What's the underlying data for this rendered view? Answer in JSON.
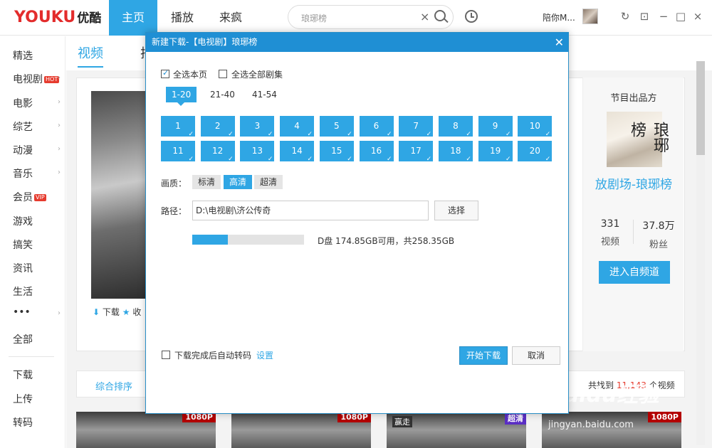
{
  "app": {
    "logo": "YOUKU",
    "logo_cn": "优酷",
    "nav": [
      "主页",
      "播放",
      "来疯"
    ],
    "search_placeholder": "琅琊榜",
    "username": "陪你M...",
    "accent": "#2fa6e4"
  },
  "sidebar": {
    "items": [
      {
        "label": "精选",
        "badge": "",
        "arrow": ""
      },
      {
        "label": "电视剧",
        "badge": "HOT",
        "arrow": "›"
      },
      {
        "label": "电影",
        "badge": "",
        "arrow": "›"
      },
      {
        "label": "综艺",
        "badge": "",
        "arrow": "›"
      },
      {
        "label": "动漫",
        "badge": "",
        "arrow": "›"
      },
      {
        "label": "音乐",
        "badge": "",
        "arrow": "›"
      },
      {
        "label": "会员",
        "badge": "VIP",
        "arrow": ""
      },
      {
        "label": "游戏",
        "badge": "",
        "arrow": ""
      },
      {
        "label": "搞笑",
        "badge": "",
        "arrow": ""
      },
      {
        "label": "资讯",
        "badge": "",
        "arrow": ""
      },
      {
        "label": "生活",
        "badge": "",
        "arrow": ""
      },
      {
        "label": "•••",
        "badge": "",
        "arrow": "›"
      },
      {
        "label": "全部",
        "badge": "",
        "arrow": ""
      }
    ],
    "bottom": [
      "下载",
      "上传",
      "转码"
    ]
  },
  "content": {
    "tab_active": "视频",
    "tab_other": "排",
    "download_label": "下载",
    "collect_label": "收",
    "sort_label": "综合排序",
    "count_prefix": "共找到",
    "count_value": "11,143",
    "count_suffix": "个视频",
    "thumb_badges": [
      "1080P",
      "1080P",
      "超清",
      "1080P"
    ],
    "thumb_label": "赢走"
  },
  "channel": {
    "title": "节目出品方",
    "name": "放剧场-琅琊榜",
    "poster_text": "琅琊榜",
    "videos_count": "331",
    "videos_label": "视频",
    "fans_count": "37.8万",
    "fans_label": "粉丝",
    "enter_button": "进入自频道"
  },
  "dialog": {
    "title": "新建下载-【电视剧】琅琊榜",
    "select_page": "全选本页",
    "select_all": "全选全部剧集",
    "ranges": [
      "1-20",
      "21-40",
      "41-54"
    ],
    "episodes": [
      "1",
      "2",
      "3",
      "4",
      "5",
      "6",
      "7",
      "8",
      "9",
      "10",
      "11",
      "12",
      "13",
      "14",
      "15",
      "16",
      "17",
      "18",
      "19",
      "20"
    ],
    "quality_label": "画质：",
    "qualities": [
      "标清",
      "高清",
      "超清"
    ],
    "path_label": "路径：",
    "path_value": "D:\\电视剧\\济公传奇",
    "choose_button": "选择",
    "disk_usage_fraction": 0.32,
    "disk_info": "D盘 174.85GB可用，共258.35GB",
    "auto_transcode": "下载完成后自动转码",
    "settings_link": "设置",
    "start_button": "开始下载",
    "cancel_button": "取消"
  },
  "watermark": {
    "main": "Baidu经验",
    "sub": "jingyan.baidu.com"
  }
}
